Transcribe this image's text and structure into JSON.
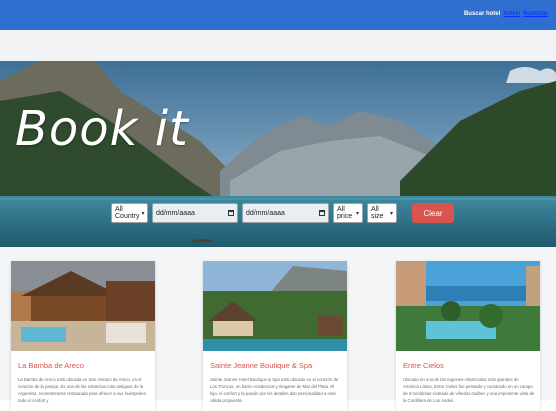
{
  "header": {
    "brand": "Buscar hotel",
    "links": [
      "Admin",
      "Bookings"
    ]
  },
  "hero": {
    "title": "Book it"
  },
  "filters": {
    "country": "All Country",
    "date_from": "dd/mm/aaaa",
    "date_to": "dd/mm/aaaa",
    "price": "All price",
    "size": "All size",
    "clear": "Clear"
  },
  "hotels": [
    {
      "name": "La Bamba de Areco",
      "description": "La Bamba de Areco está ubicada en San Antonio de Areco, en el corazón de la pampa. Es una de las estancias más antiguas de la Argentina, recientemente restaurada para ofrecer a sus huéspedes todo el confort y"
    },
    {
      "name": "Sainte Jeanne Boutique & Spa",
      "description": "Sainte Jeanne Hotel Boutique & Spa está ubicado en el corazón de Los Troncos, un barrio residencial y elegante de Mar del Plata. El lujo, el confort y la pasión por los detalles dan personalidad a esta cálida propuesta."
    },
    {
      "name": "Entre Cielos",
      "description": "Ubicado en una de las regiones vitivinícolas más grandes de América Latina, Entre Cielos fue pensado y construido en un campo de 8 hectáreas rodeado de viñedos malbec y una imponente vista de la Cordillera de Los Andes."
    }
  ],
  "colors": {
    "topbar": "#2f6fd0",
    "accent": "#d9534f",
    "link": "#0b2cff"
  }
}
